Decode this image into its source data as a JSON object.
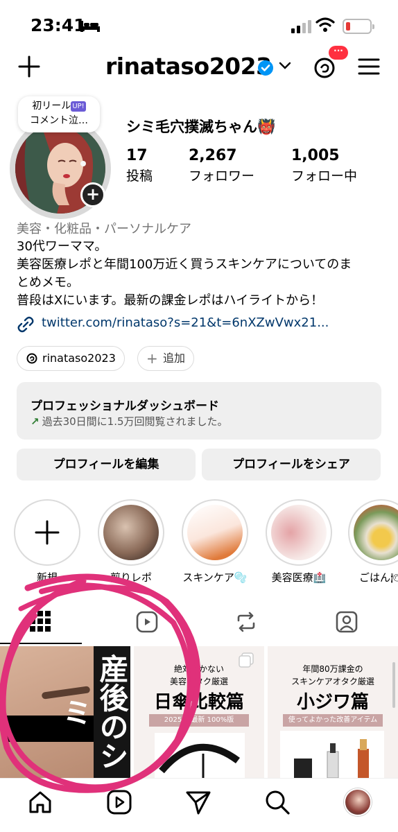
{
  "status_bar": {
    "time": "23:41"
  },
  "header": {
    "username": "rinataso2023",
    "threads_badge": "···"
  },
  "profile": {
    "note_line1": "初リール",
    "note_up": "UP!",
    "note_line2": "コメント泣…",
    "display_name": "シミ毛穴撲滅ちゃん👹",
    "stats": [
      {
        "num": "17",
        "label": "投稿"
      },
      {
        "num": "2,267",
        "label": "フォロワー"
      },
      {
        "num": "1,005",
        "label": "フォロー中"
      }
    ],
    "category": "美容・化粧品・パーソナルケア",
    "bio_lines": [
      "30代ワーママ。",
      "美容医療レポと年間100万近く買うスキンケアについてのま",
      "とめメモ。",
      "普段はXにいます。最新の課金レポはハイライトから！"
    ],
    "link": "twitter.com/rinataso?s=21&t=6nXZwVwx21..."
  },
  "chips": {
    "threads": "rinataso2023",
    "add": "追加"
  },
  "dashboard": {
    "title": "プロフェッショナルダッシュボード",
    "subtitle": "過去30日間に1.5万回閲覧されました。"
  },
  "buttons": {
    "edit": "プロフィールを編集",
    "share": "プロフィールをシェア"
  },
  "highlights": [
    {
      "label": "新規"
    },
    {
      "label": "剪りレポ"
    },
    {
      "label": "スキンケア🫧"
    },
    {
      "label": "美容医療🏥"
    },
    {
      "label": "ごはん🍽"
    }
  ],
  "grid": {
    "post1_side": "産後のシミ",
    "post2": {
      "cap1": "絶対焼かない",
      "cap2": "美容オタク厳選",
      "big": "日傘比較篇",
      "band": "2025年 最新 100%版"
    },
    "post3": {
      "cap1": "年間80万課金の",
      "cap2": "スキンケアオタク厳選",
      "big": "小ジワ篇",
      "band": "使ってよかった改善アイテム"
    }
  },
  "colors": {
    "annotation": "#e0317a",
    "link": "#00376b",
    "badge": "#ff3040",
    "verified": "#0095f6"
  }
}
